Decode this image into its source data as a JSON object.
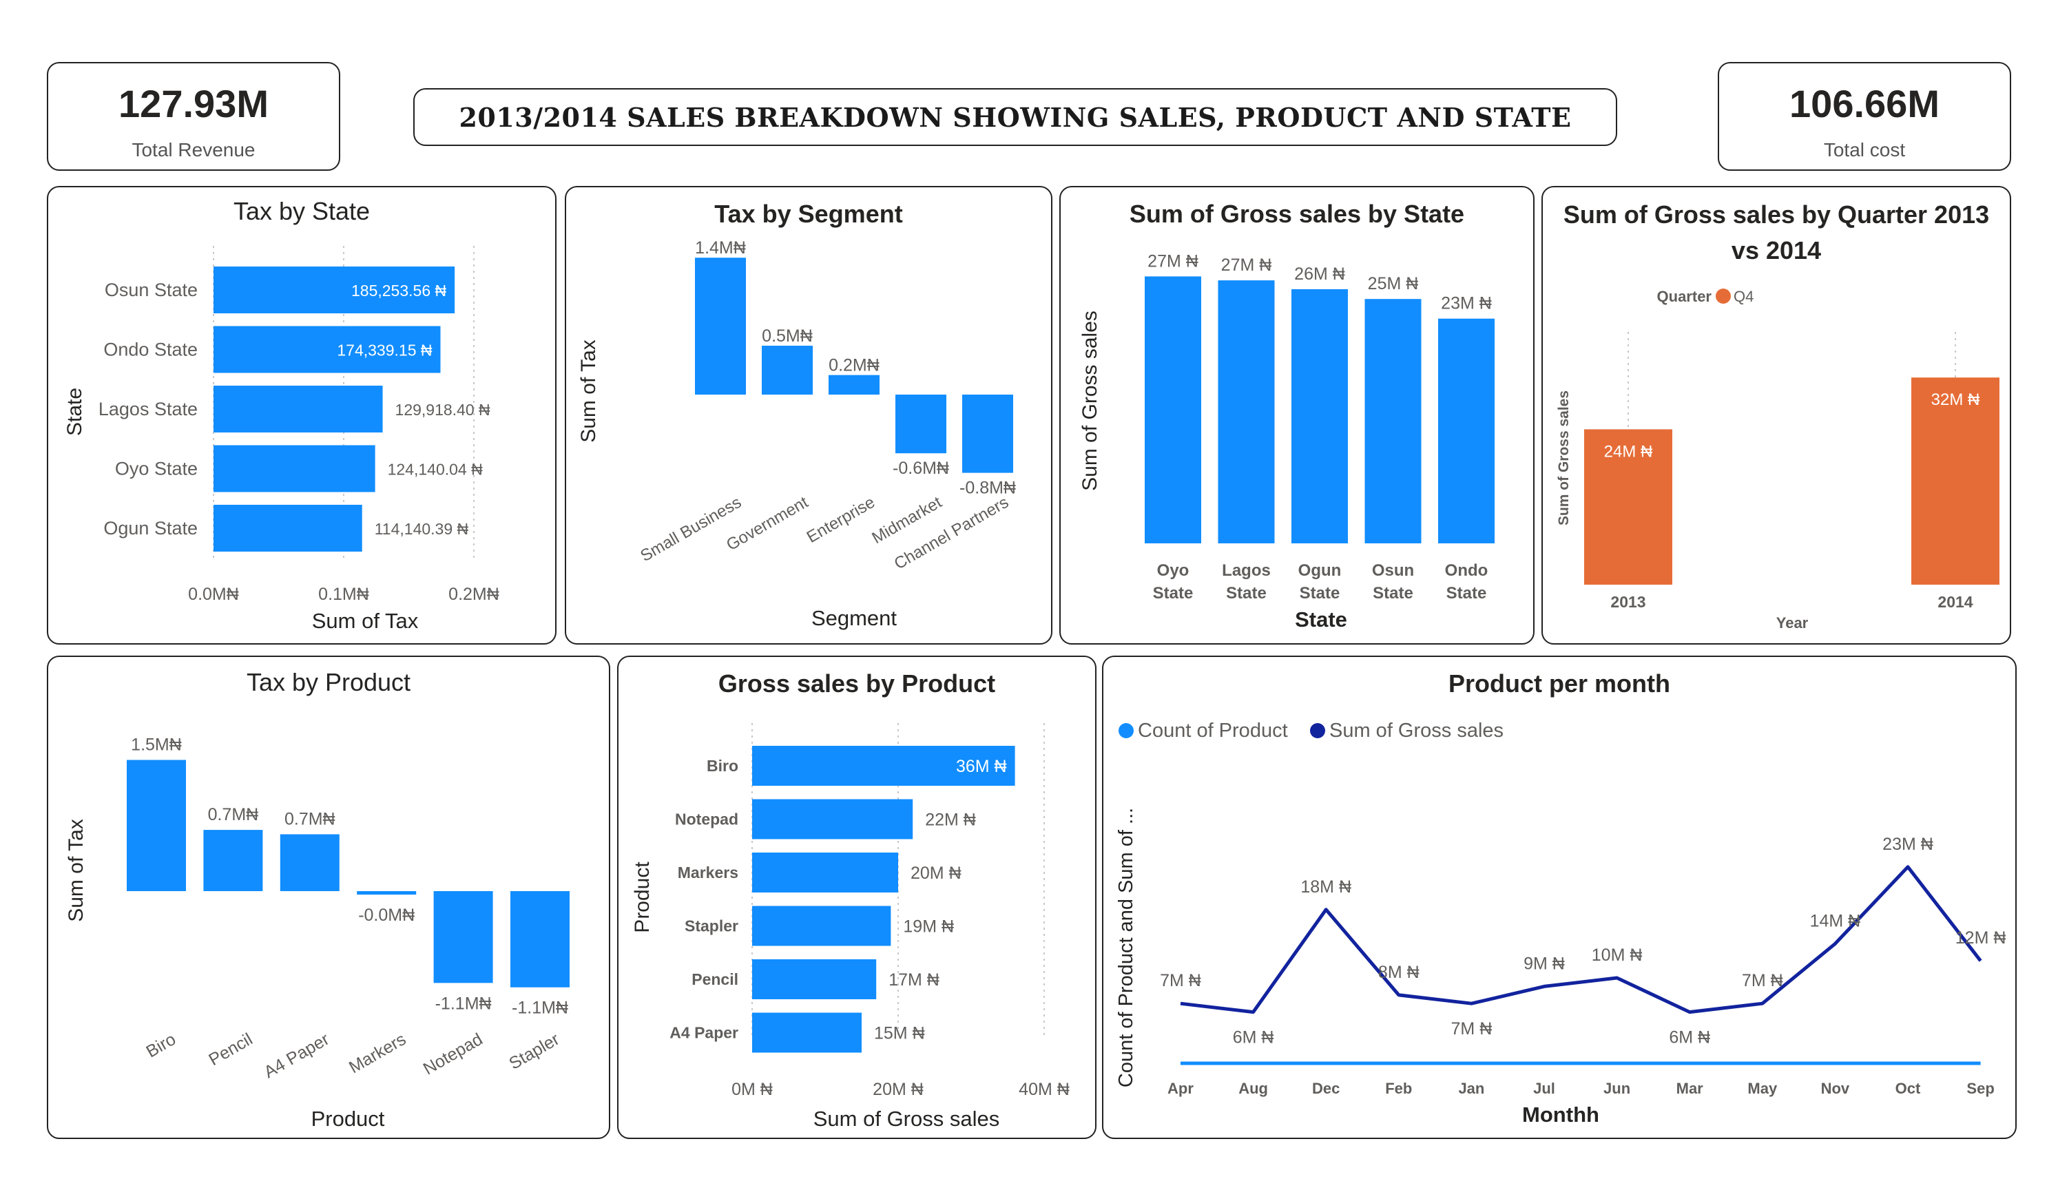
{
  "kpis": {
    "revenue": {
      "value": "127.93M",
      "label": "Total Revenue"
    },
    "cost": {
      "value": "106.66M",
      "label": "Total cost"
    }
  },
  "title": "2013/2014 SALES BREAKDOWN SHOWING SALES, PRODUCT AND STATE",
  "colors": {
    "blue": "#118DFF",
    "orange": "#E66C37",
    "navy": "#12239E"
  },
  "chart_data": [
    {
      "id": "tax_by_state",
      "type": "bar",
      "orientation": "horizontal",
      "title": "Tax by State",
      "xlabel": "Sum of Tax",
      "ylabel": "State",
      "categories": [
        "Osun State",
        "Ondo State",
        "Lagos State",
        "Oyo State",
        "Ogun State"
      ],
      "values": [
        185253.56,
        174339.15,
        129918.4,
        124140.04,
        114140.39
      ],
      "data_labels": [
        "185,253.56 ₦",
        "174,339.15 ₦",
        "129,918.40 ₦",
        "124,140.04 ₦",
        "114,140.39 ₦"
      ],
      "xlim": [
        0,
        200000
      ],
      "xticks": [
        "0.0M₦",
        "0.1M₦",
        "0.2M₦"
      ]
    },
    {
      "id": "tax_by_segment",
      "type": "bar",
      "title": "Tax by Segment",
      "xlabel": "Segment",
      "ylabel": "Sum of Tax",
      "categories": [
        "Small Business",
        "Government",
        "Enterprise",
        "Midmarket",
        "Channel Partners"
      ],
      "values": [
        1.4,
        0.5,
        0.2,
        -0.6,
        -0.8
      ],
      "data_labels": [
        "1.4M₦",
        "0.5M₦",
        "0.2M₦",
        "-0.6M₦",
        "-0.8M₦"
      ]
    },
    {
      "id": "gross_by_state",
      "type": "bar",
      "title": "Sum of Gross sales by State",
      "xlabel": "State",
      "ylabel": "Sum of Gross sales",
      "categories": [
        "Oyo State",
        "Lagos State",
        "Ogun State",
        "Osun State",
        "Ondo State"
      ],
      "values": [
        27.2,
        26.8,
        25.9,
        24.9,
        22.9
      ],
      "data_labels": [
        "27M ₦",
        "27M ₦",
        "26M ₦",
        "25M ₦",
        "23M ₦"
      ]
    },
    {
      "id": "gross_by_quarter",
      "type": "bar",
      "title": "Sum of Gross sales by Quarter 2013 vs 2014",
      "xlabel": "Year",
      "ylabel": "Sum of Gross sales",
      "legend": {
        "title": "Quarter",
        "items": [
          "Q4"
        ]
      },
      "categories": [
        "2013",
        "2014"
      ],
      "values": [
        24,
        32
      ],
      "data_labels": [
        "24M ₦",
        "32M ₦"
      ]
    },
    {
      "id": "tax_by_product",
      "type": "bar",
      "title": "Tax by Product",
      "xlabel": "Product",
      "ylabel": "Sum of Tax",
      "categories": [
        "Biro",
        "Pencil",
        "A4 Paper",
        "Markers",
        "Notepad",
        "Stapler"
      ],
      "values": [
        1.5,
        0.7,
        0.65,
        -0.04,
        -1.05,
        -1.1
      ],
      "data_labels": [
        "1.5M₦",
        "0.7M₦",
        "0.7M₦",
        "-0.0M₦",
        "-1.1M₦",
        "-1.1M₦"
      ]
    },
    {
      "id": "gross_by_product",
      "type": "bar",
      "orientation": "horizontal",
      "title": "Gross sales by Product",
      "xlabel": "Sum of Gross sales",
      "ylabel": "Product",
      "categories": [
        "Biro",
        "Notepad",
        "Markers",
        "Stapler",
        "Pencil",
        "A4 Paper"
      ],
      "values": [
        36,
        22,
        20,
        19,
        17,
        15
      ],
      "data_labels": [
        "36M ₦",
        "22M ₦",
        "20M ₦",
        "19M ₦",
        "17M ₦",
        "15M ₦"
      ],
      "xlim": [
        0,
        40
      ],
      "xticks": [
        "0M ₦",
        "20M ₦",
        "40M ₦"
      ]
    },
    {
      "id": "product_per_month",
      "type": "line",
      "title": "Product per month",
      "xlabel": "Monthh",
      "ylabel": "Count of Product and Sum of ...",
      "legend": [
        "Count of Product",
        "Sum of Gross sales"
      ],
      "categories": [
        "Apr",
        "Aug",
        "Dec",
        "Feb",
        "Jan",
        "Jul",
        "Jun",
        "Mar",
        "May",
        "Nov",
        "Oct",
        "Sep"
      ],
      "series": [
        {
          "name": "Count of Product",
          "values": [
            0,
            0,
            0,
            0,
            0,
            0,
            0,
            0,
            0,
            0,
            0,
            0
          ]
        },
        {
          "name": "Sum of Gross sales",
          "values": [
            7,
            6,
            18,
            8,
            7,
            9,
            10,
            6,
            7,
            14,
            23,
            12
          ],
          "data_labels": [
            "7M ₦",
            "6M ₦",
            "18M ₦",
            "8M ₦",
            "7M ₦",
            "9M ₦",
            "10M ₦",
            "6M ₦",
            "7M ₦",
            "14M ₦",
            "23M ₦",
            "12M ₦"
          ]
        }
      ]
    }
  ]
}
